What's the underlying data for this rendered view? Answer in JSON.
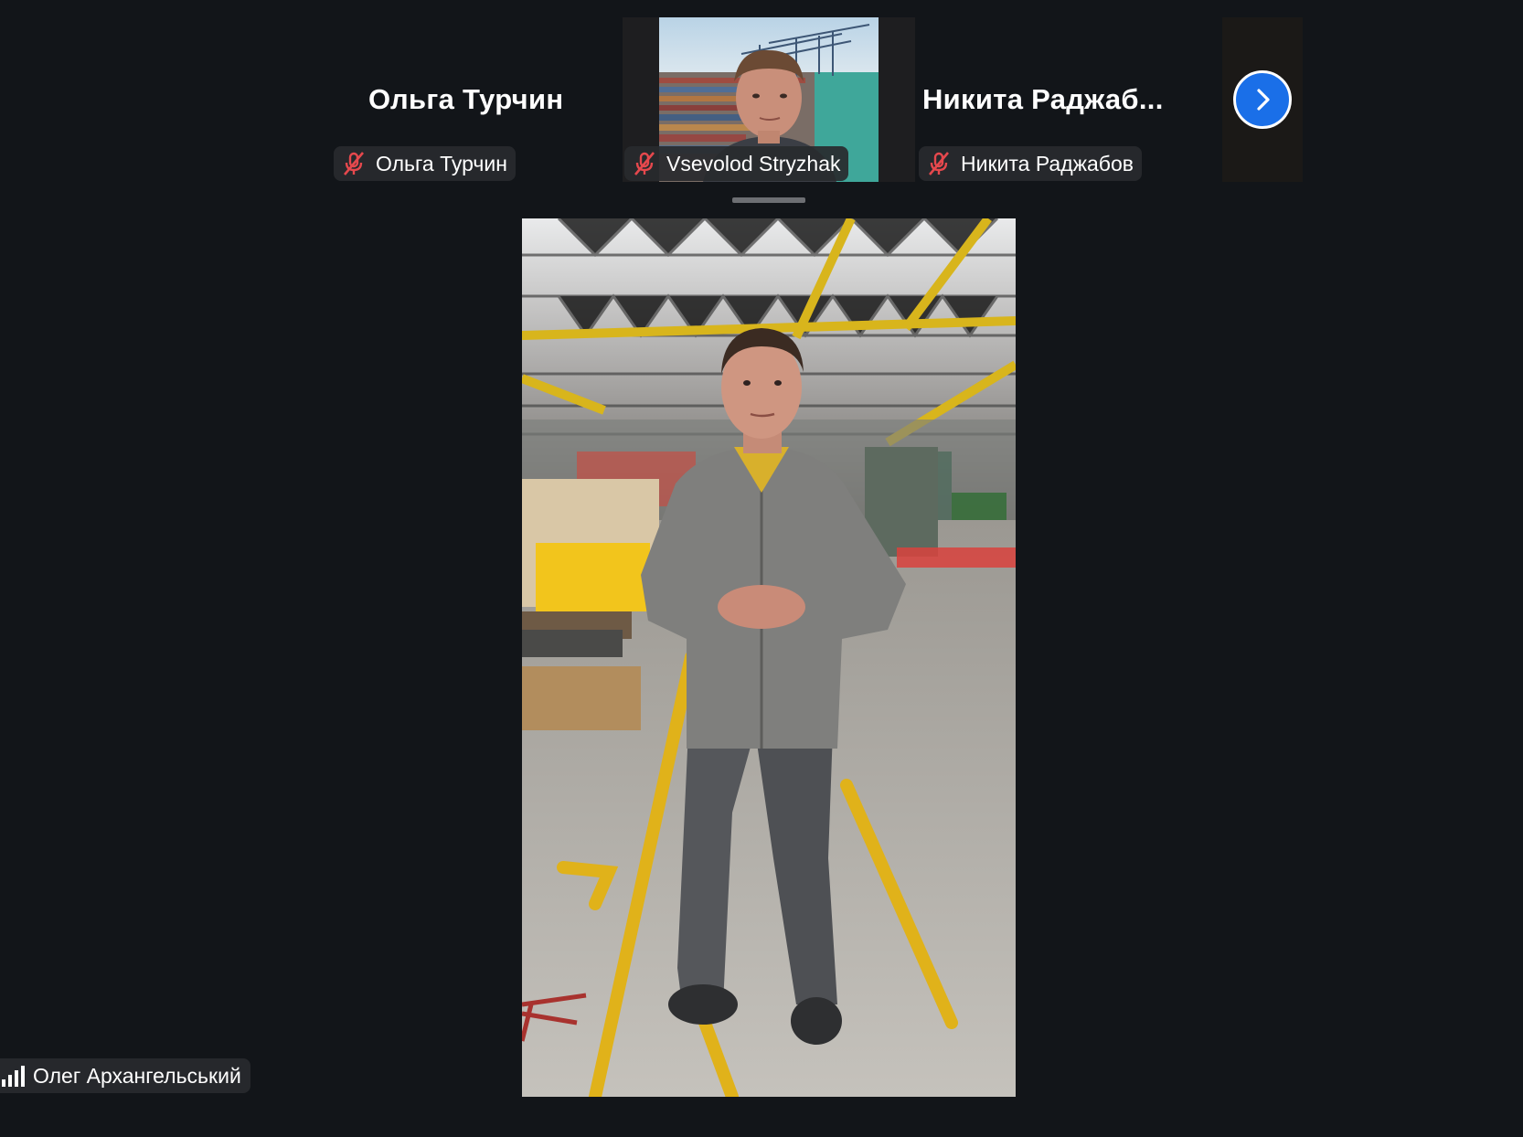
{
  "participants_strip": {
    "tiles": [
      {
        "display_name": "Ольга Турчин",
        "badge_name": "Ольга Турчин",
        "muted": true,
        "video_on": false
      },
      {
        "display_name": "Vsevolod Stryzhak",
        "badge_name": "Vsevolod Stryzhak",
        "muted": true,
        "video_on": true
      },
      {
        "display_name": "Никита  Раджаб...",
        "badge_name": "Никита Раджабов",
        "muted": true,
        "video_on": false
      }
    ],
    "next_page_icon": "chevron-right-icon"
  },
  "active_speaker": {
    "video_on": true
  },
  "self_view": {
    "name": "Олег Архангельський",
    "signal_icon": "signal-bars-icon"
  },
  "colors": {
    "background": "#121519",
    "accent_blue": "#1a6fe8",
    "muted_red": "#e5484d"
  }
}
